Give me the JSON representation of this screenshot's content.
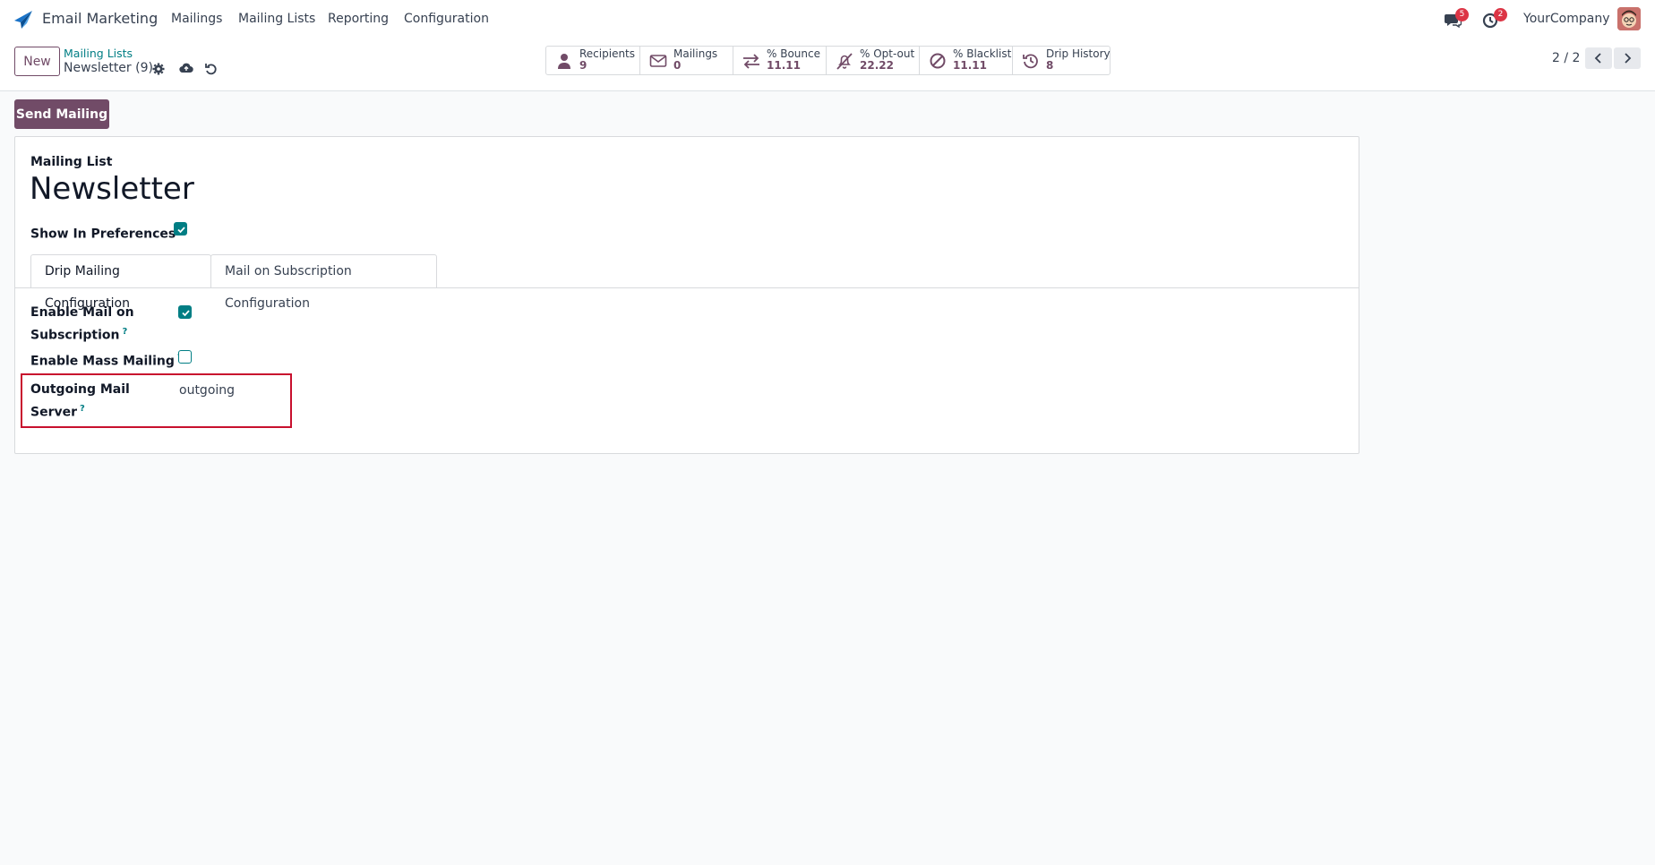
{
  "navbar": {
    "app_name": "Email Marketing",
    "menu": [
      "Mailings",
      "Mailing Lists",
      "Reporting",
      "Configuration"
    ],
    "messages_badge": "5",
    "activities_badge": "2",
    "company": "YourCompany"
  },
  "control_panel": {
    "new_label": "New",
    "breadcrumb_parent": "Mailing Lists",
    "breadcrumb_current": "Newsletter (9)",
    "stats": [
      {
        "label": "Recipients",
        "value": "9",
        "icon": "user-icon"
      },
      {
        "label": "Mailings",
        "value": "0",
        "icon": "envelope-icon"
      },
      {
        "label": "% Bounce",
        "value": "11.11",
        "icon": "exchange-icon"
      },
      {
        "label": "% Opt-out",
        "value": "22.22",
        "icon": "bell-slash-icon"
      },
      {
        "label": "% Blacklist",
        "value": "11.11",
        "icon": "ban-icon"
      },
      {
        "label": "Drip History",
        "value": "8",
        "icon": "history-icon"
      }
    ],
    "pager": "2 / 2"
  },
  "actions": {
    "send_mailing": "Send Mailing"
  },
  "form": {
    "title_label": "Mailing List",
    "title": "Newsletter",
    "show_in_preferences_label": "Show In Preferences",
    "show_in_preferences": true,
    "tabs": [
      "Drip Mailing Configuration",
      "Mail on Subscription Configuration"
    ],
    "active_tab": 0,
    "enable_mail_on_subscription_label_1": "Enable Mail on",
    "enable_mail_on_subscription_label_2": "Subscription",
    "enable_mail_on_subscription": true,
    "enable_mass_mailing_label": "Enable Mass Mailing",
    "enable_mass_mailing": false,
    "outgoing_mail_server_label_1": "Outgoing Mail",
    "outgoing_mail_server_label_2": "Server",
    "outgoing_mail_server": "outgoing",
    "help_mark": "?"
  },
  "colors": {
    "brand": "#714b67",
    "accent": "#017e84",
    "highlight": "#c8102e"
  }
}
